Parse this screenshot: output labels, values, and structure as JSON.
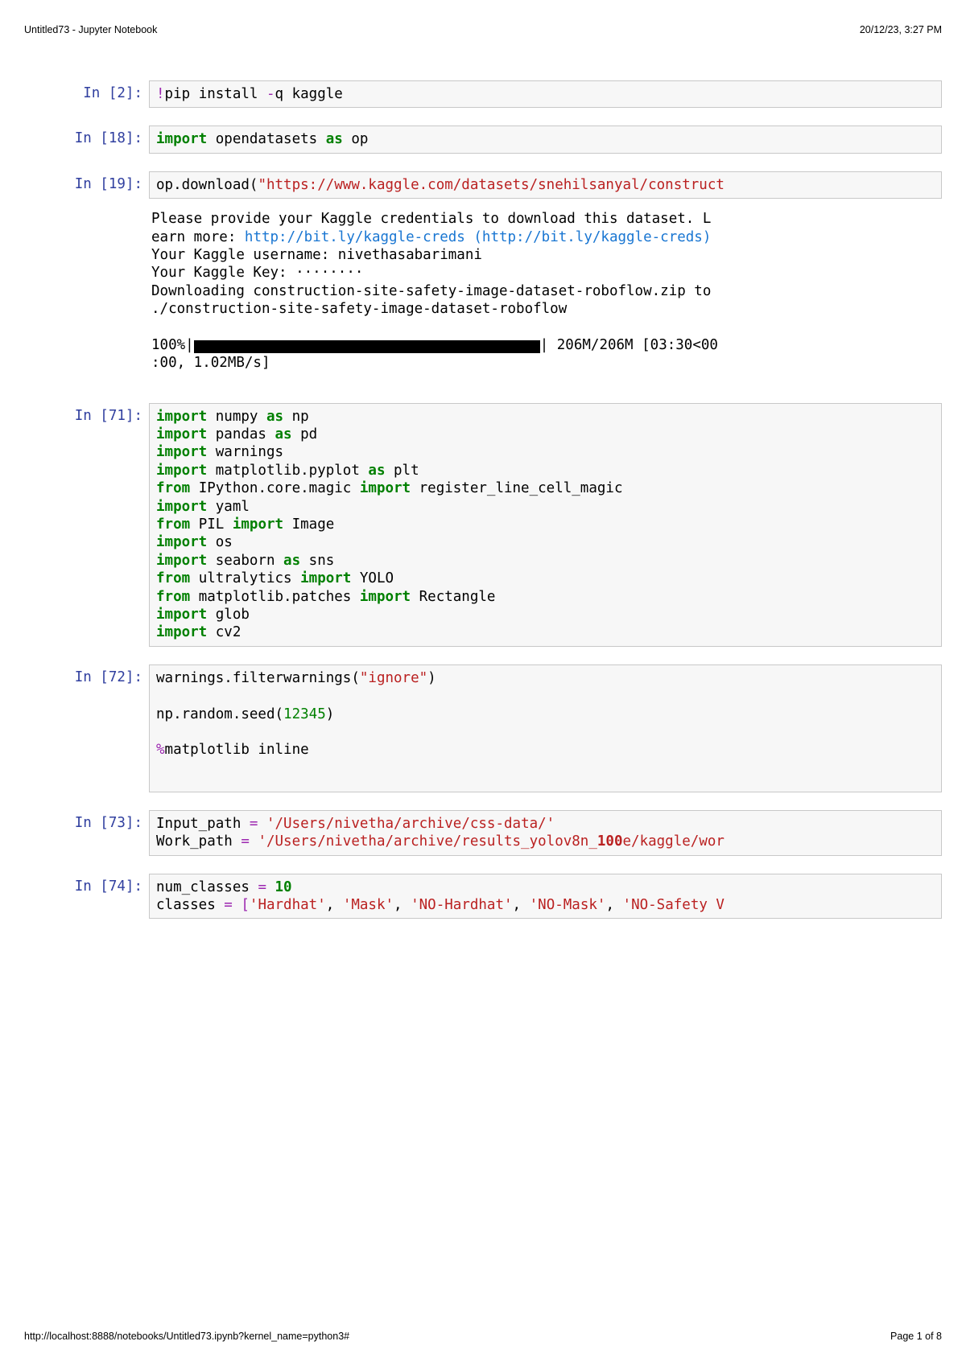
{
  "header": {
    "left": "Untitled73 - Jupyter Notebook",
    "right": "20/12/23, 3:27 PM"
  },
  "footer": {
    "left": "http://localhost:8888/notebooks/Untitled73.ipynb?kernel_name=python3#",
    "right": "Page 1 of 8"
  },
  "cells": {
    "c0": {
      "prompt": "In [2]:"
    },
    "c1": {
      "prompt": "In [18]:"
    },
    "c2": {
      "prompt": "In [19]:"
    },
    "c3": {
      "prompt": "In [71]:"
    },
    "c4": {
      "prompt": "In [72]:"
    },
    "c5": {
      "prompt": "In [73]:"
    },
    "c6": {
      "prompt": "In [74]:"
    }
  },
  "code": {
    "pip_pre": "!",
    "pip_cmd": "pip install ",
    "pip_flag": "-",
    "pip_flag2": "q kaggle",
    "import_kw": "import",
    "as_kw": "as",
    "from_kw": "from",
    "opendatasets": " opendatasets ",
    "op_alias": " op",
    "op_call": "op.download(",
    "url": "\"https://www.kaggle.com/datasets/snehilsanyal/construct",
    "numpy": " numpy ",
    "np": " np",
    "pandas": " pandas ",
    "pd": " pd",
    "warnings": " warnings",
    "mpl": " matplotlib.pyplot ",
    "plt": " plt",
    "ipy1": " IPython.core.magic ",
    "ipy2": " register_line_cell_magic",
    "yaml": " yaml",
    "pil1": " PIL ",
    "pil2": " Image",
    "os": " os",
    "sns1": " seaborn ",
    "sns2": " sns",
    "ultra1": " ultralytics ",
    "ultra2": " YOLO",
    "patch1": " matplotlib.patches ",
    "patch2": " Rectangle",
    "glob": " glob",
    "cv2": " cv2",
    "warn_call": "warnings.filterwarnings(",
    "ignore": "\"ignore\"",
    "paren_close": ")",
    "seed1": "np.random.seed(",
    "seed_n": "12345",
    "magic": "%",
    "magic_txt": "matplotlib inline",
    "in_path1": "Input_path ",
    "eq": "=",
    "in_path2": " '/Users/nivetha/archive/css-data/'",
    "wk_path1": "Work_path ",
    "wk_path2": " '/Users/nivetha/archive/results_yolov8n_",
    "wk_path_bold": "100",
    "wk_path3": "e/kaggle/wor",
    "nc1": "num_classes ",
    "nc2": "= ",
    "nc_n": "10",
    "cls1": "classes ",
    "cls2": "= [",
    "hardhat": "'Hardhat'",
    "mask": "'Mask'",
    "nohardhat": "'NO-Hardhat'",
    "nomask": "'NO-Mask'",
    "nosafety": "'NO-Safety V",
    "comma": ", "
  },
  "output": {
    "line1a": "Please provide your Kaggle credentials to download this dataset. L",
    "line1b": "earn more: ",
    "link_txt": "http://bit.ly/kaggle-creds (http://bit.ly/kaggle-creds)",
    "line2": "Your Kaggle username: nivethasabarimani",
    "line3": "Your Kaggle Key: ········",
    "line4": "Downloading construction-site-safety-image-dataset-roboflow.zip to",
    "line5": "./construction-site-safety-image-dataset-roboflow",
    "prog_pre": "100%|",
    "prog_post": "| 206M/206M [03:30<00",
    "prog_line2": ":00, 1.02MB/s]"
  }
}
